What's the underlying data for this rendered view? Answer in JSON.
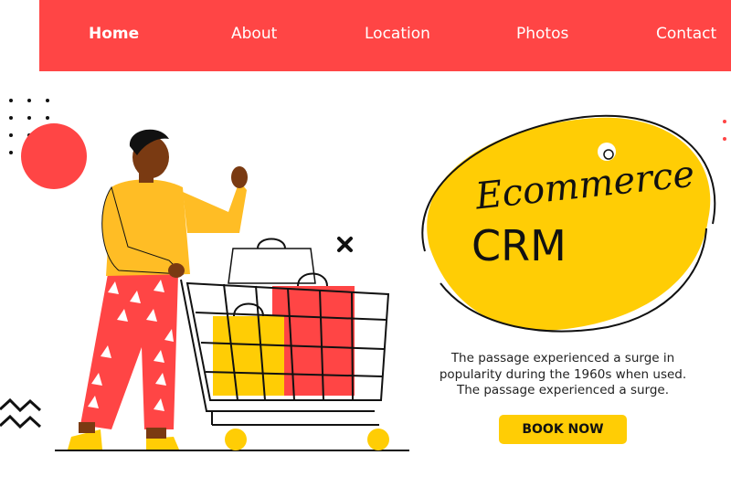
{
  "nav": {
    "items": [
      {
        "label": "Home",
        "active": true
      },
      {
        "label": "About",
        "active": false
      },
      {
        "label": "Location",
        "active": false
      },
      {
        "label": "Photos",
        "active": false
      },
      {
        "label": "Contact",
        "active": false
      }
    ]
  },
  "hero": {
    "title": "Ecommerce",
    "subtitle": "CRM",
    "description": "The passage experienced a surge in popularity during the 1960s when used. The passage experienced a surge.",
    "cta_label": "BOOK NOW"
  },
  "colors": {
    "nav_bg": "#ff4545",
    "accent_yellow": "#ffcd05",
    "accent_red": "#ff4545",
    "text_dark": "#111111"
  },
  "illustration": {
    "subject": "person-with-shopping-cart",
    "icons": [
      "dot-grid-icon",
      "red-circle-icon",
      "zigzag-icon",
      "close-x-icon",
      "tag-hole-icon"
    ]
  }
}
